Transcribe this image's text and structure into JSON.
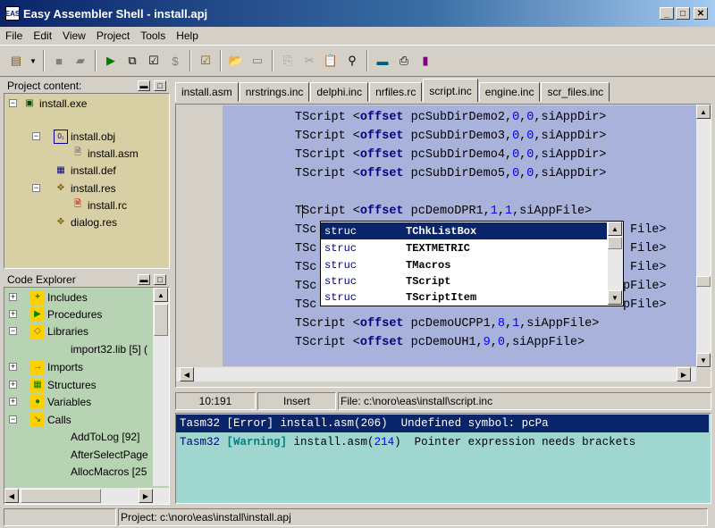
{
  "window": {
    "title": "Easy Assembler Shell  - install.apj"
  },
  "menu": {
    "file": "File",
    "edit": "Edit",
    "view": "View",
    "project": "Project",
    "tools": "Tools",
    "help": "Help"
  },
  "project_panel": {
    "title": "Project content:",
    "items": [
      {
        "label": "install.exe"
      },
      {
        "label": "install.obj"
      },
      {
        "label": "install.asm"
      },
      {
        "label": "install.def"
      },
      {
        "label": "install.res"
      },
      {
        "label": "install.rc"
      },
      {
        "label": "dialog.res"
      }
    ]
  },
  "code_explorer": {
    "title": "Code Explorer",
    "items": [
      {
        "label": "Includes"
      },
      {
        "label": "Procedures"
      },
      {
        "label": "Libraries"
      },
      {
        "label": "import32.lib [5] ("
      },
      {
        "label": "Imports"
      },
      {
        "label": "Structures"
      },
      {
        "label": "Variables"
      },
      {
        "label": "Calls"
      },
      {
        "label": "AddToLog [92]"
      },
      {
        "label": "AfterSelectPage"
      },
      {
        "label": "AllocMacros [25"
      }
    ]
  },
  "tabs": [
    "install.asm",
    "nrstrings.inc",
    "delphi.inc",
    "nrfiles.rc",
    "script.inc",
    "engine.inc",
    "scr_files.inc"
  ],
  "editor": {
    "lines": [
      {
        "pre": "TScript <",
        "kw": "offset",
        "mid": " pcSubDirDemo2,",
        "a": "0",
        "s1": ",",
        "b": "0",
        "s2": ",siAppDir>"
      },
      {
        "pre": "TScript <",
        "kw": "offset",
        "mid": " pcSubDirDemo3,",
        "a": "0",
        "s1": ",",
        "b": "0",
        "s2": ",siAppDir>"
      },
      {
        "pre": "TScript <",
        "kw": "offset",
        "mid": " pcSubDirDemo4,",
        "a": "0",
        "s1": ",",
        "b": "0",
        "s2": ",siAppDir>"
      },
      {
        "pre": "TScript <",
        "kw": "offset",
        "mid": " pcSubDirDemo5,",
        "a": "0",
        "s1": ",",
        "b": "0",
        "s2": ",siAppDir>"
      },
      {
        "pre": "",
        "kw": "",
        "mid": "",
        "a": "",
        "s1": "",
        "b": "",
        "s2": ""
      },
      {
        "pre": "TScript <",
        "kw": "offset",
        "mid": " pcDemoDPR1,",
        "a": "1",
        "s1": ",",
        "b": "1",
        "s2": ",siAppFile>"
      },
      {
        "pre": "TSc",
        "kw": "",
        "mid": "",
        "a": "",
        "s1": "",
        "b": "",
        "s2": "",
        "tail": "File>"
      },
      {
        "pre": "TSc",
        "kw": "",
        "mid": "",
        "a": "",
        "s1": "",
        "b": "",
        "s2": "",
        "tail": "File>"
      },
      {
        "pre": "TSc",
        "kw": "",
        "mid": "",
        "a": "",
        "s1": "",
        "b": "",
        "s2": "",
        "tail": "File>"
      },
      {
        "pre": "TSc",
        "kw": "",
        "mid": "",
        "a": "",
        "s1": "",
        "b": "",
        "s2": "",
        "tail": "pFile>"
      },
      {
        "pre": "TSc",
        "kw": "",
        "mid": "",
        "a": "",
        "s1": "",
        "b": "",
        "s2": "",
        "tail": "pFile>"
      },
      {
        "pre": "TScript <",
        "kw": "offset",
        "mid": " pcDemoUCPP1,",
        "a": "8",
        "s1": ",",
        "b": "1",
        "s2": ",siAppFile>"
      },
      {
        "pre": "TScript <",
        "kw": "offset",
        "mid": " pcDemoUH1,",
        "a": "9",
        "s1": ",",
        "b": "0",
        "s2": ",siAppFile>"
      }
    ]
  },
  "autocomplete": {
    "items": [
      {
        "kind": "struc",
        "name": "TChkListBox"
      },
      {
        "kind": "struc",
        "name": "TEXTMETRIC"
      },
      {
        "kind": "struc",
        "name": "TMacros"
      },
      {
        "kind": "struc",
        "name": "TScript"
      },
      {
        "kind": "struc",
        "name": "TScriptItem"
      }
    ]
  },
  "status": {
    "position": "10:191",
    "mode": "Insert",
    "file": "File: c:\\noro\\eas\\install\\script.inc"
  },
  "messages": [
    {
      "tool": "Tasm32",
      "level": "[Error]",
      "file": " install.asm(",
      "line": "206",
      "rest": ")  Undefined symbol: pcPa"
    },
    {
      "tool": "Tasm32",
      "level": "[Warning]",
      "file": " install.asm(",
      "line": "214",
      "rest": ")  Pointer expression needs brackets"
    }
  ],
  "statusbar": {
    "project": "Project: c:\\noro\\eas\\install\\install.apj"
  },
  "colors": {
    "editor_bg": "#a9b2db",
    "selected_line_bg": "#0a246a",
    "project_bg": "#d9cfa4",
    "explorer_bg": "#b8d2b4",
    "messages_bg": "#9fd6cf"
  }
}
